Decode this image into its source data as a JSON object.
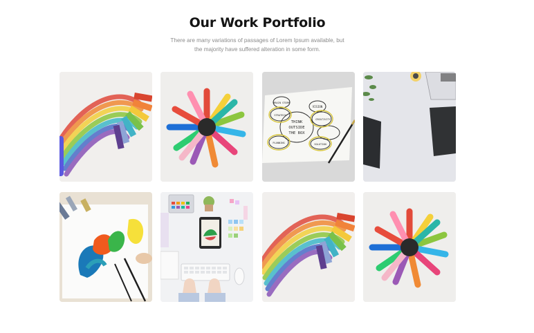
{
  "section": {
    "title": "Our Work Portfolio",
    "subtitle_line1": "There are many variations of passages of Lorem Ipsum available, but",
    "subtitle_line2": "the majority have suffered alteration in some form."
  },
  "portfolio": {
    "items": [
      {
        "image": "rainbow-pastel-crayons"
      },
      {
        "image": "colored-markers-circle"
      },
      {
        "image": "think-outside-the-box-sketch"
      },
      {
        "image": "laptop-tablet-desk"
      },
      {
        "image": "paint-brush-strokes"
      },
      {
        "image": "design-desk-keyboard-tablet"
      },
      {
        "image": "rainbow-pastel-crayons"
      },
      {
        "image": "colored-markers-circle"
      }
    ]
  },
  "sketch_text": [
    "THINK",
    "OUTSIDE",
    "THE BOX",
    "VISION",
    "BRAIN STORM",
    "STRATEGY",
    "CREATIVITY",
    "PLANNING",
    "SOLUTION"
  ],
  "colors": {
    "accent_tab": "#5a58e0",
    "title": "#141414",
    "subtitle": "#8a8a8a"
  }
}
